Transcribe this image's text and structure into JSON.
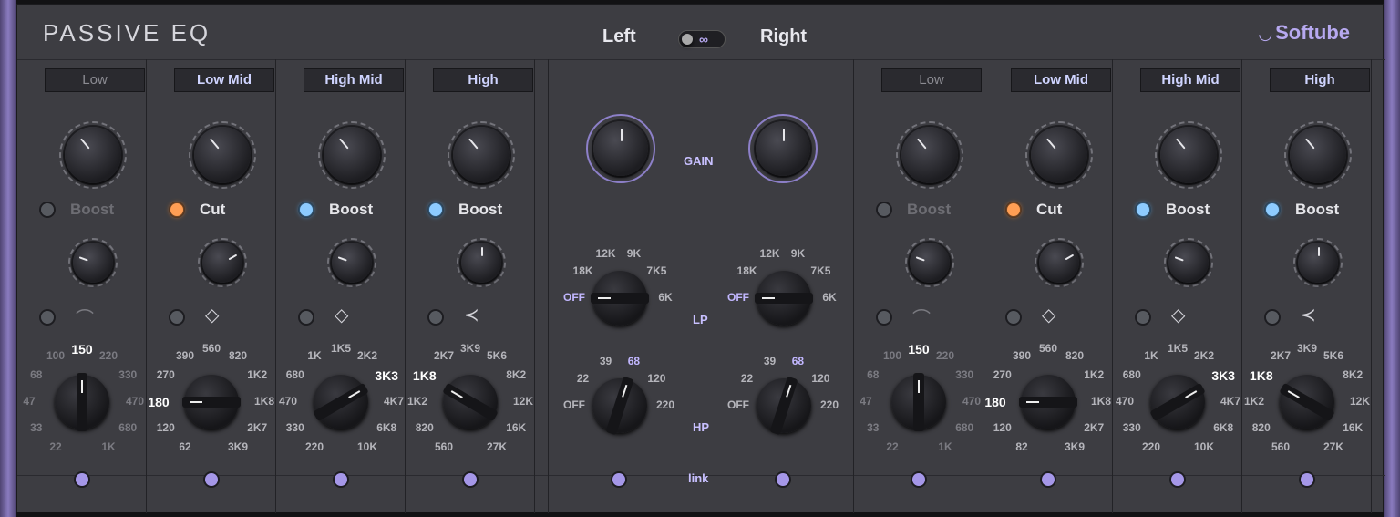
{
  "header": {
    "title": "PASSIVE EQ",
    "brand": "Softube",
    "left_label": "Left",
    "right_label": "Right"
  },
  "colors": {
    "accent": "#a597e8",
    "lamp_orange": "#ff9e54",
    "lamp_blue": "#8dcbff",
    "panel": "#3d3d42"
  },
  "bands_left": [
    {
      "label": "Low",
      "mode": "Boost",
      "mode_active": false,
      "lamp": "gray",
      "freqs": [
        "22",
        "33",
        "47",
        "68",
        "100",
        "150",
        "220",
        "330",
        "470",
        "680",
        "1K"
      ],
      "selected": "150"
    },
    {
      "label": "Low Mid",
      "mode": "Cut",
      "mode_active": true,
      "lamp": "orange",
      "freqs": [
        "62",
        "120",
        "180",
        "270",
        "390",
        "560",
        "820",
        "1K2",
        "1K8",
        "2K7",
        "3K9"
      ],
      "selected": "180"
    },
    {
      "label": "High Mid",
      "mode": "Boost",
      "mode_active": true,
      "lamp": "blue",
      "freqs": [
        "220",
        "330",
        "470",
        "680",
        "1K",
        "1K5",
        "2K2",
        "3K3",
        "4K7",
        "6K8",
        "10K"
      ],
      "selected": "3K3"
    },
    {
      "label": "High",
      "mode": "Boost",
      "mode_active": true,
      "lamp": "blue",
      "freqs": [
        "560",
        "820",
        "1K2",
        "1K8",
        "2K7",
        "3K9",
        "5K6",
        "8K2",
        "12K",
        "16K",
        "27K"
      ],
      "selected": "1K8"
    }
  ],
  "bands_right": [
    {
      "label": "Low",
      "mode": "Boost",
      "mode_active": false,
      "lamp": "gray",
      "freqs": [
        "22",
        "33",
        "47",
        "68",
        "100",
        "150",
        "220",
        "330",
        "470",
        "680",
        "1K"
      ],
      "selected": "150"
    },
    {
      "label": "Low Mid",
      "mode": "Cut",
      "mode_active": true,
      "lamp": "orange",
      "freqs": [
        "82",
        "120",
        "180",
        "270",
        "390",
        "560",
        "820",
        "1K2",
        "1K8",
        "2K7",
        "3K9"
      ],
      "selected": "180"
    },
    {
      "label": "High Mid",
      "mode": "Boost",
      "mode_active": true,
      "lamp": "blue",
      "freqs": [
        "220",
        "330",
        "470",
        "680",
        "1K",
        "1K5",
        "2K2",
        "3K3",
        "4K7",
        "6K8",
        "10K"
      ],
      "selected": "3K3"
    },
    {
      "label": "High",
      "mode": "Boost",
      "mode_active": true,
      "lamp": "blue",
      "freqs": [
        "560",
        "820",
        "1K2",
        "1K8",
        "2K7",
        "3K9",
        "5K6",
        "8K2",
        "12K",
        "16K",
        "27K"
      ],
      "selected": "1K8"
    }
  ],
  "center": {
    "gain_label": "GAIN",
    "lp_label": "LP",
    "hp_label": "HP",
    "link_label": "link",
    "lp_freqs": [
      "OFF",
      "18K",
      "12K",
      "9K",
      "7K5",
      "6K"
    ],
    "lp_selected": "OFF",
    "hp_freqs": [
      "OFF",
      "22",
      "39",
      "68",
      "120",
      "220"
    ],
    "hp_selected": "68"
  }
}
